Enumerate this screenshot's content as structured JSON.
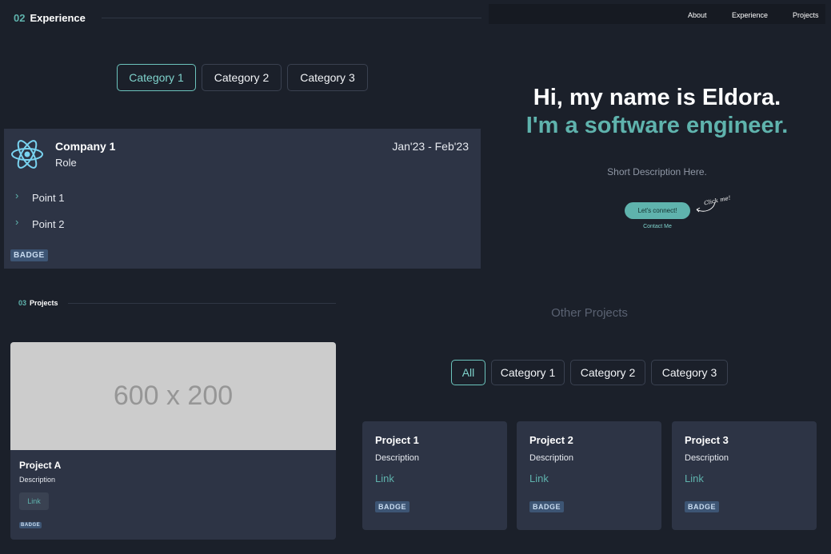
{
  "experience": {
    "section_number": "02",
    "section_title": "Experience",
    "tabs": [
      {
        "label": "Category 1",
        "active": true
      },
      {
        "label": "Category 2",
        "active": false
      },
      {
        "label": "Category 3",
        "active": false
      }
    ],
    "card": {
      "icon": "react-atom-icon",
      "company": "Company 1",
      "role": "Role",
      "dates": "Jan'23 - Feb'23",
      "points": [
        "Point 1",
        "Point 2"
      ],
      "badge": "BADGE"
    }
  },
  "nav": {
    "links": [
      "About",
      "Experience",
      "Projects"
    ]
  },
  "hero": {
    "greeting": "Hi, my name is Eldora.",
    "tagline": "I'm a software engineer.",
    "description": "Short Description Here.",
    "cta_label": "Let's connect!",
    "cta_annotation": "Click me!",
    "contact_link": "Contact Me"
  },
  "projects": {
    "section_number": "03",
    "section_title": "Projects",
    "featured": {
      "image_placeholder": "600 x 200",
      "title": "Project A",
      "description": "Description",
      "link_label": "Link",
      "badge": "BADGE"
    },
    "other": {
      "title": "Other Projects",
      "tabs": [
        {
          "label": "All",
          "active": true
        },
        {
          "label": "Category 1",
          "active": false
        },
        {
          "label": "Category 2",
          "active": false
        },
        {
          "label": "Category 3",
          "active": false
        }
      ],
      "cards": [
        {
          "title": "Project 1",
          "description": "Description",
          "link": "Link",
          "badge": "BADGE"
        },
        {
          "title": "Project 2",
          "description": "Description",
          "link": "Link",
          "badge": "BADGE"
        },
        {
          "title": "Project 3",
          "description": "Description",
          "link": "Link",
          "badge": "BADGE"
        }
      ]
    }
  },
  "colors": {
    "background": "#1b202a",
    "card": "#2d3445",
    "accent": "#5fb3ad",
    "badge": "#3d5574"
  }
}
